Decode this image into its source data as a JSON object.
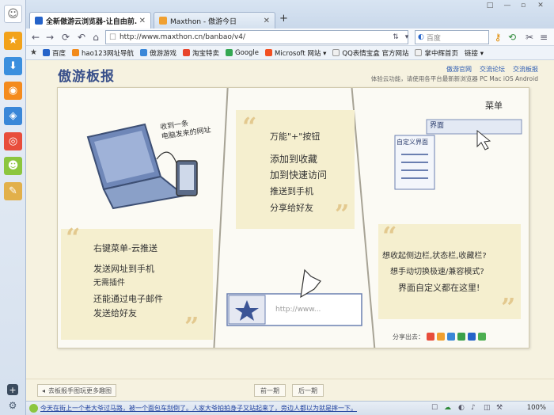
{
  "tabs": [
    {
      "title": "全新傲游云浏览器-让自由前..."
    },
    {
      "title": "Maxthon - 傲游今日"
    }
  ],
  "new_tab_label": "+",
  "window_buttons": [
    "□",
    "—",
    "▫",
    "✕"
  ],
  "address": {
    "url": "http://www.maxthon.cn/banbao/v4/"
  },
  "search": {
    "engine": "百度",
    "placeholder": "百度"
  },
  "bookmarks": [
    {
      "label": "百度",
      "color": "#2563c9"
    },
    {
      "label": "hao123网址导航",
      "color": "#f28a1a"
    },
    {
      "label": "傲游游戏",
      "color": "#3a87d8"
    },
    {
      "label": "淘宝特卖",
      "color": "#e8452c"
    },
    {
      "label": "Google",
      "color": "#34a853"
    },
    {
      "label": "Microsoft 网站 ▾",
      "color": "#f25022"
    },
    {
      "label": "QQ表情宝盒 官方网站",
      "color": "#f0f0f0"
    },
    {
      "label": "掌中辉首页",
      "color": "#f0f0f0"
    },
    {
      "label": "链接 ▾",
      "color": "#eef3f9"
    }
  ],
  "page": {
    "brand": "傲游板报",
    "links": [
      "傲游官网",
      "交流论坛",
      "交流板报"
    ],
    "subtitle": "体验云功能，请使用各平台最新新浏览器 PC Mac iOS Android",
    "col1": {
      "bubble": "收到一条\n电脑发来的网址",
      "heading": "右键菜单-云推送",
      "lines": [
        "发送网址到手机",
        "无需插件",
        "还能通过电子邮件",
        "发送给好友"
      ]
    },
    "col2": {
      "heading": "万能\"+\"按钮",
      "lines": [
        "添加到收藏",
        "加到快速访问",
        "推送到手机",
        "分享给好友"
      ],
      "url_hint": "http://www..."
    },
    "col3": {
      "menu_label": "菜单",
      "ui_label": "界面",
      "custom_label": "自定义界面",
      "lines": [
        "想收起侧边栏,状态栏,收藏栏?",
        "想手动切换极速/兼容模式?",
        "界面自定义都在这里!"
      ]
    },
    "share_label": "分享出去："
  },
  "pager": {
    "left": "去板报手图玩更多趣图",
    "prev": "前一期",
    "next": "后一期"
  },
  "status": {
    "news": "今天在街上一个老大爷过马路，被一个面包车刮倒了。人家大爷拍拍身子又站起来了，旁边人都以为就是摔一下。",
    "zoom": "100%"
  }
}
